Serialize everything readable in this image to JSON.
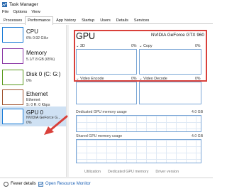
{
  "window": {
    "title": "Task Manager",
    "colors": {
      "accent_blue": "#7aa6d6",
      "highlight_red": "#d9403a",
      "selected_bg": "#cfe1f3",
      "link": "#1a5fb4"
    }
  },
  "menu": {
    "items": [
      "File",
      "Options",
      "View"
    ]
  },
  "tabs": {
    "items": [
      "Processes",
      "Performance",
      "App history",
      "Startup",
      "Users",
      "Details",
      "Services"
    ],
    "active": "Performance"
  },
  "sidebar": {
    "items": [
      {
        "name": "CPU",
        "line1": "6% 0.92 GHz",
        "line2": "",
        "color": "#1a7bd6"
      },
      {
        "name": "Memory",
        "line1": "5.1/7.8 GB (65%)",
        "line2": "",
        "color": "#8b39a6"
      },
      {
        "name": "Disk 0 (C: G:)",
        "line1": "0%",
        "line2": "",
        "color": "#5a9a1e"
      },
      {
        "name": "Ethernet",
        "line1": "Ethernet",
        "line2": "S: 0 R: 0 Kbps",
        "color": "#a0522d"
      },
      {
        "name": "GPU 0",
        "line1": "NVIDIA GeForce G...",
        "line2": "0%",
        "color": "#1a7bd6"
      }
    ],
    "selected_index": 4
  },
  "main": {
    "title": "GPU",
    "model": "NVIDIA GeForce GTX 960",
    "engines": [
      {
        "label": "3D",
        "pct": "0%"
      },
      {
        "label": "Copy",
        "pct": "0%"
      },
      {
        "label": "Video Encode",
        "pct": "0%"
      },
      {
        "label": "Video Decode",
        "pct": "0%"
      }
    ],
    "dedicated": {
      "label": "Dedicated GPU memory usage",
      "value": "4.0 GB"
    },
    "shared": {
      "label": "Shared GPU memory usage",
      "value": "4.0 GB"
    },
    "bottom_labels": [
      "Utilization",
      "Dedicated GPU memory",
      "Driver version"
    ]
  },
  "footer": {
    "fewer_details": "Fewer details",
    "open_monitor": "Open Resource Monitor"
  }
}
